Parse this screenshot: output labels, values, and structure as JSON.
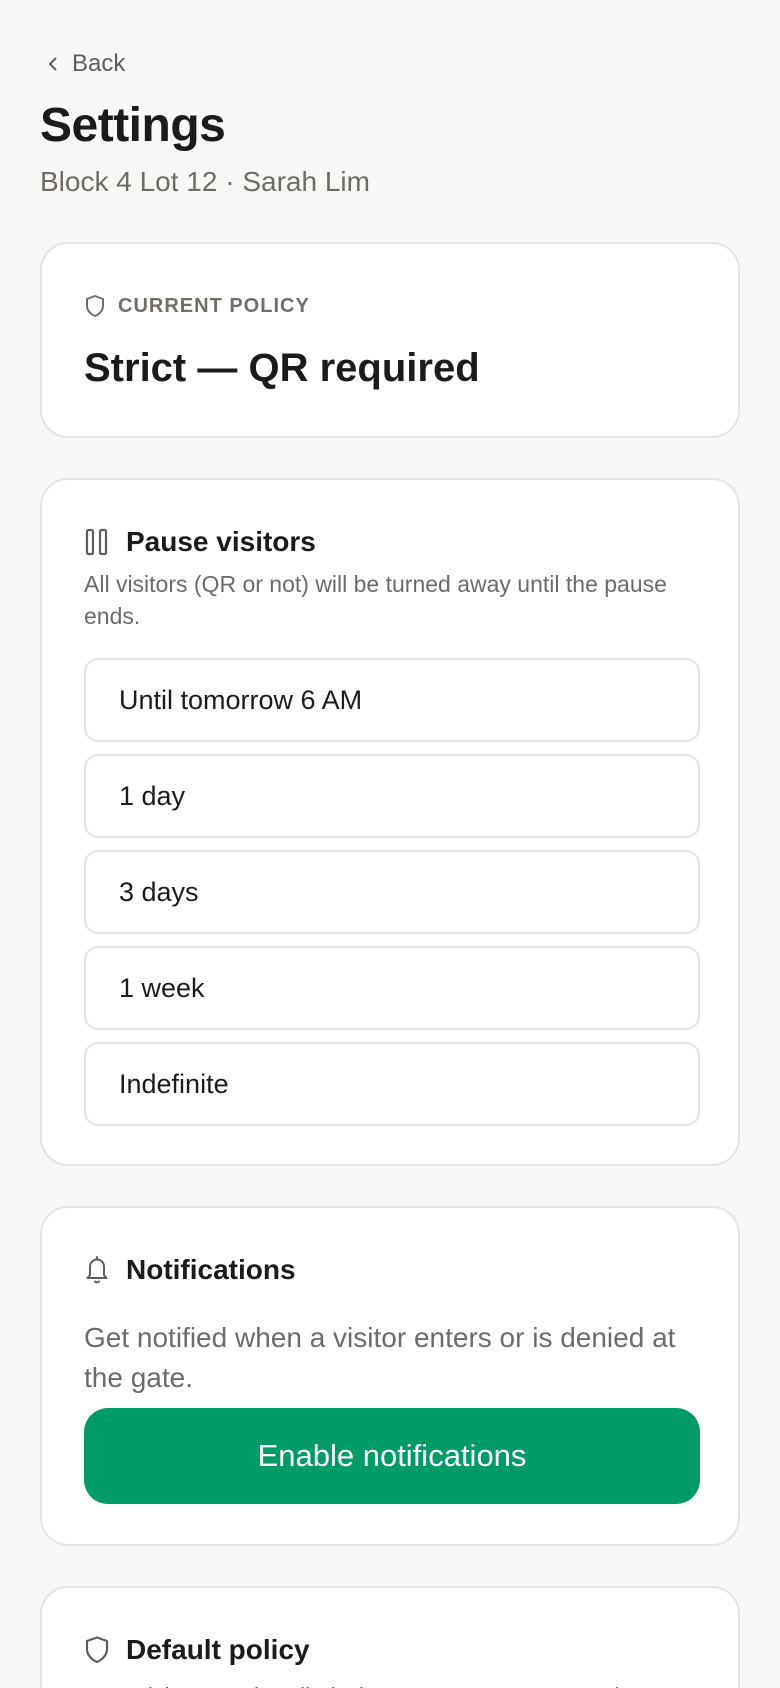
{
  "nav": {
    "back_label": "Back"
  },
  "header": {
    "title": "Settings",
    "subtitle": "Block 4 Lot 12 · Sarah Lim"
  },
  "current_policy": {
    "eyebrow": "CURRENT POLICY",
    "value": "Strict — QR required",
    "icon": "shield-icon"
  },
  "pause": {
    "title": "Pause visitors",
    "description": "All visitors (QR or not) will be turned away until the pause ends.",
    "icon": "pause-icon",
    "options": [
      {
        "label": "Until tomorrow 6 AM"
      },
      {
        "label": "1 day"
      },
      {
        "label": "3 days"
      },
      {
        "label": "1 week"
      },
      {
        "label": "Indefinite"
      }
    ]
  },
  "notifications": {
    "title": "Notifications",
    "description": "Get notified when a visitor enters or is denied at the gate.",
    "button_label": "Enable notifications",
    "icon": "bell-icon"
  },
  "default_policy": {
    "title": "Default policy",
    "description": "How visitors are handled when no temporary pause is",
    "icon": "shield-icon"
  },
  "colors": {
    "accent": "#009b67",
    "background": "#f9f8f6",
    "card": "#ffffff",
    "muted_text": "#6e6b67"
  }
}
